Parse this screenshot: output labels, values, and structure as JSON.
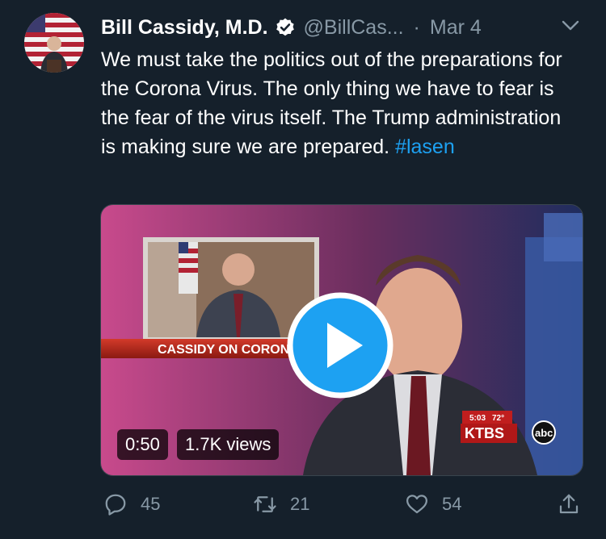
{
  "tweet": {
    "author_name": "Bill Cassidy, M.D.",
    "handle": "@BillCas...",
    "separator": "·",
    "date": "Mar 4",
    "text_main": "We must take the politics out of the preparations for the Corona Virus. The only thing we have to fear is the fear of the virus itself. The Trump administration is making sure we are prepared. ",
    "hashtag": "#lasen"
  },
  "video": {
    "duration": "0:50",
    "views": "1.7K views",
    "lower_third": "CASSIDY ON CORONAV",
    "station_time": "5:03",
    "station_temp": "72°",
    "station_logo": "KTBS",
    "network_logo": "abc"
  },
  "actions": {
    "reply_count": "45",
    "retweet_count": "21",
    "like_count": "54"
  },
  "colors": {
    "background": "#15202b",
    "secondary_text": "#8899a6",
    "accent": "#1da1f2"
  },
  "icons": [
    "verified-badge-icon",
    "caret-down-icon",
    "play-icon",
    "reply-icon",
    "retweet-icon",
    "like-icon",
    "share-icon"
  ]
}
